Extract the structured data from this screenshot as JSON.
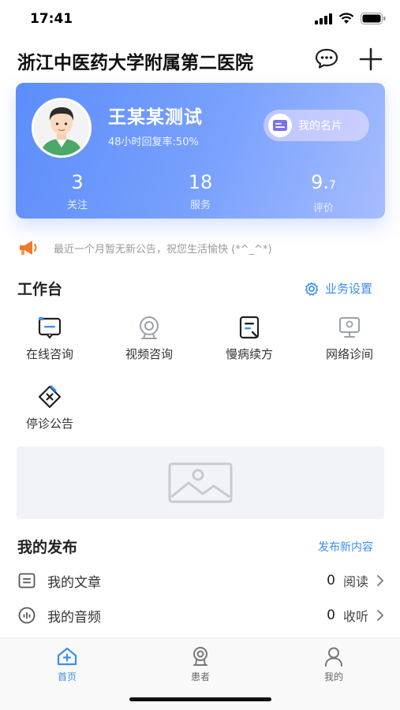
{
  "status": {
    "time": "17:41"
  },
  "nav": {
    "title": "浙江中医药大学附属第二医院"
  },
  "profile": {
    "name": "王某某测试",
    "reply_rate": "48小时回复率:50%",
    "card_button": "我的名片",
    "stats": [
      {
        "value": "3",
        "label": "关注"
      },
      {
        "value": "18",
        "label": "服务"
      },
      {
        "value": "9.",
        "decimal": "7",
        "label": "评价"
      }
    ]
  },
  "notice": {
    "text": "最近一个月暂无新公告，祝您生活愉快 (*^_^*)"
  },
  "workbench": {
    "title": "工作台",
    "settings_link": "业务设置",
    "tools": [
      {
        "label": "在线咨询",
        "icon": "chat-box-icon"
      },
      {
        "label": "视频咨询",
        "icon": "camera-icon"
      },
      {
        "label": "慢病续方",
        "icon": "prescription-icon"
      },
      {
        "label": "网络诊间",
        "icon": "monitor-icon"
      },
      {
        "label": "停诊公告",
        "icon": "stop-notice-icon"
      }
    ]
  },
  "publish": {
    "title": "我的发布",
    "new_link": "发布新内容",
    "items": [
      {
        "label": "我的文章",
        "count": "0",
        "unit": "阅读",
        "icon": "article-icon"
      },
      {
        "label": "我的音频",
        "count": "0",
        "unit": "收听",
        "icon": "audio-icon"
      }
    ]
  },
  "tabs": [
    {
      "label": "首页",
      "icon": "home-icon",
      "active": true
    },
    {
      "label": "患者",
      "icon": "patient-icon",
      "active": false
    },
    {
      "label": "我的",
      "icon": "user-icon",
      "active": false
    }
  ],
  "colors": {
    "accent": "#3c8ef0",
    "card_start": "#5c8dfb",
    "card_end": "#a6bdfd",
    "notice_icon": "#f07a2c"
  }
}
